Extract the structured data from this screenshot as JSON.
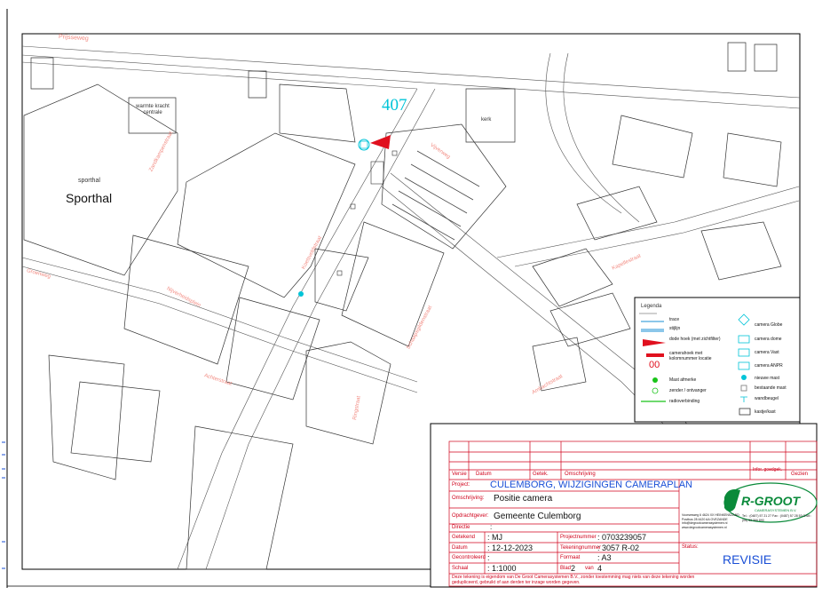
{
  "map": {
    "camera_number": "407",
    "building_labels": {
      "sporthal_small": "sporthal",
      "sporthal_big": "Sporthal",
      "warmte_kracht": "warmte kracht centrale",
      "kerk": "kerk"
    },
    "street_labels": {
      "prijsweg": "Prijsseweg",
      "zandkampen": "Zandkampenstraat",
      "koetsveld": "Koetsveldstraat",
      "vijverweg": "Vijverweg",
      "schaapsgildenstraat": "Schaapsgildenstraat",
      "groenweg": "Groenweg",
      "nijverheidsplein": "Nijverheidsplein",
      "kapellestraat": "Kapellestraat",
      "achterstraat": "Achterstraat",
      "ambachtstraat": "Ambachtstraat",
      "ringstraat": "Ringstraat"
    }
  },
  "legend": {
    "title": "Legenda",
    "left": [
      {
        "label": "trace",
        "icon": "line-blue"
      },
      {
        "label": "stijlijn",
        "icon": "line-double"
      },
      {
        "label": "dode hoek (met zichtfilter)",
        "icon": "red-triangle"
      },
      {
        "label": "camerahoek met kolomnummer locatie",
        "icon": "red-bar"
      },
      {
        "label": "Mast afmerke",
        "icon": "green-dot"
      },
      {
        "label": "zender / ontvanger",
        "icon": "green-circle"
      },
      {
        "label": "radioverbinding",
        "icon": "green-arrow"
      }
    ],
    "right": [
      {
        "label": "camera Globe",
        "icon": "camera-globe"
      },
      {
        "label": "camera dome",
        "icon": "camera-dome"
      },
      {
        "label": "camera Vast",
        "icon": "camera-vast"
      },
      {
        "label": "camera ANPR",
        "icon": "camera-anpr"
      },
      {
        "label": "nieuwe mast",
        "icon": "cyan-dot"
      },
      {
        "label": "bestaande mast",
        "icon": "grey-square"
      },
      {
        "label": "wandbeugel",
        "icon": "wall-t"
      },
      {
        "label": "kastje/kast",
        "icon": "box"
      }
    ],
    "sample_number": "00"
  },
  "title_block": {
    "headers": {
      "versie": "Versie",
      "datum": "Datum",
      "getek": "Getek.",
      "omschrijving": "Omschrijving",
      "infor": "Infor. goedgek.",
      "gezien": "Gezien"
    },
    "project_label": "Project:",
    "project_value": "CULEMBORG, WIJZIGINGEN CAMERAPLAN",
    "omschrijving_label": "Omschrijving:",
    "omschrijving_value": "Positie camera",
    "opdrachtgever_label": "Opdrachtgever:",
    "opdrachtgever_value": "Gemeente Culemborg",
    "directie_label": "Directie",
    "directie_value": ":",
    "getekend_label": "Getekend",
    "getekend_value": ": MJ",
    "datum_label": "Datum",
    "datum_value": ": 12-12-2023",
    "gecontroleerd_label": "Gecontroleerd",
    "gecontroleerd_value": ":",
    "schaal_label": "Schaal",
    "schaal_value": ": 1:1000",
    "projectnummer_label": "Projectnummer",
    "projectnummer_value": ": 0703239057",
    "tekeningnummer_label": "Tekeningnummer",
    "tekeningnummer_value": ": 3057 R-02",
    "formaat_label": "Formaat",
    "formaat_value": ": A3",
    "blad_label": "Blad",
    "blad_value": "2",
    "van_label": "van",
    "van_value": "4",
    "status_label": "Status:",
    "status_value": "REVISIE",
    "company_name": "R-GROOT",
    "company_sub": "CAMERASYSTEMEN B.V.",
    "company_address": "Voorsesweg 6 4624 XX HEINKENSZAND Postbus 28 4420 AA OVEZANDE info@degrootcamerasystemen.nl www.degrootcamerasystemen.nl",
    "company_phone": "Tel. : (0487) 57 21 27 Fax : (0487) 57 28 53 GSM : (06) 53 366 890",
    "disclaimer": "Deze tekening is eigendom van De Groot Camerasystemen B.V., zonder toestemming mag niets van deze tekening worden gedupliceerd, gebruikt of aan derden ter inzage worden gegeven."
  },
  "colors": {
    "street_label": "#f28b82",
    "camera_cyan": "#00c4d8",
    "red": "#d0021b",
    "blue_text": "#1a4fd6"
  }
}
